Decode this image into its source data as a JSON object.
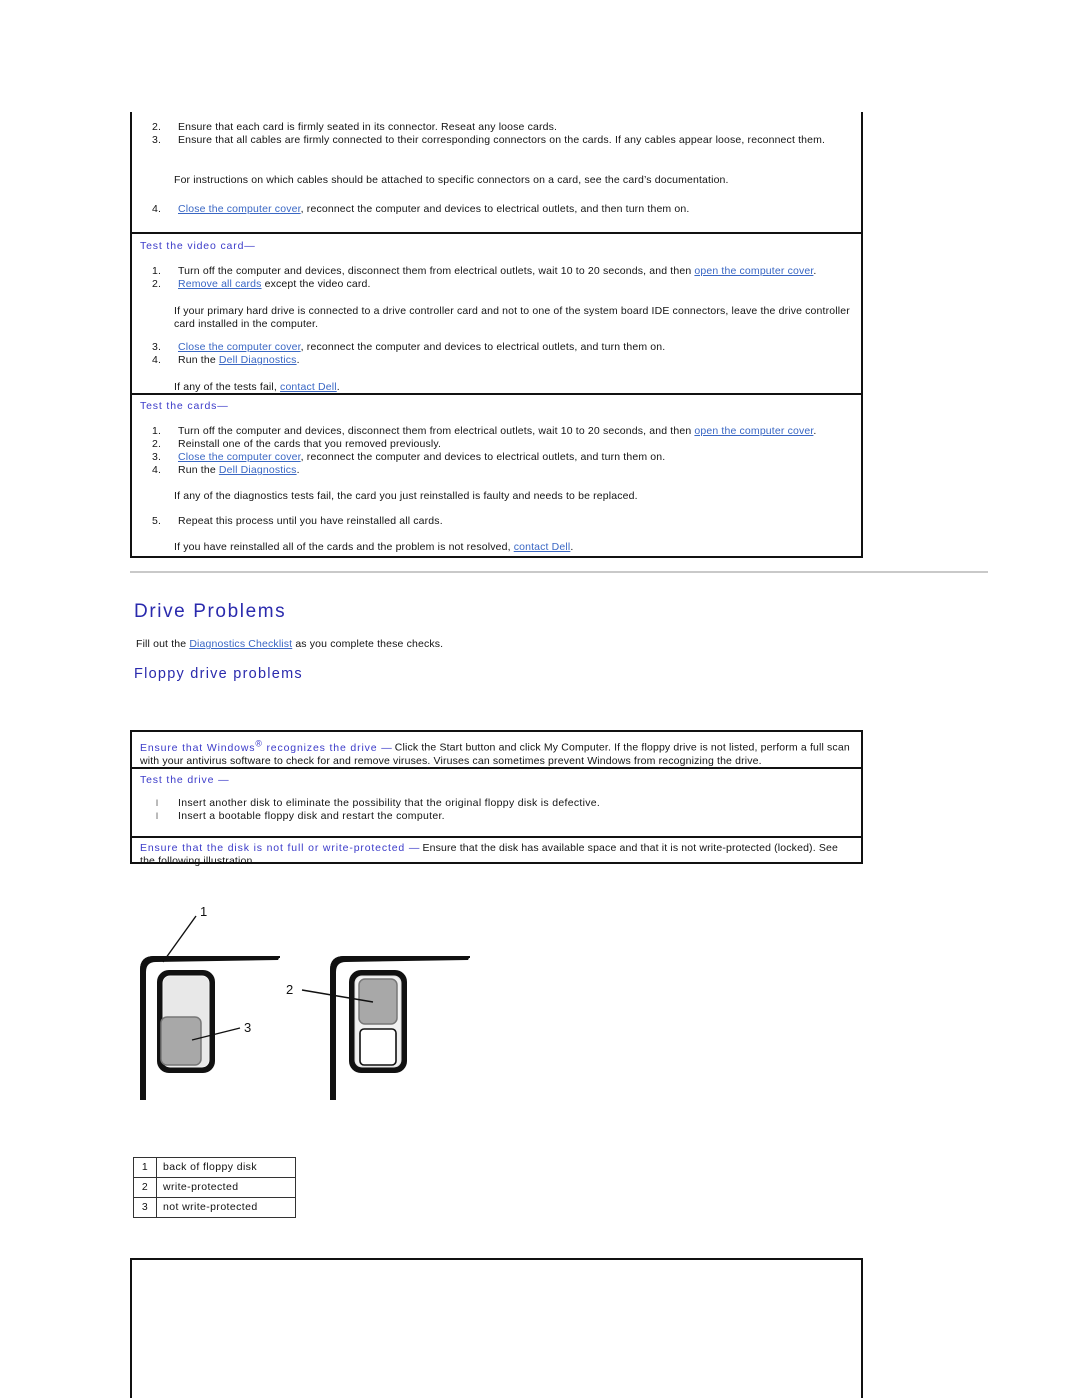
{
  "document": {
    "title": "Drive Problems"
  },
  "top_box": {
    "steps": [
      {
        "num": "2.",
        "text": "Ensure that each card is firmly seated in its connector. Reseat any loose cards."
      },
      {
        "num": "3.",
        "text": "Ensure that all cables are firmly connected to their corresponding connectors on the cards. If any cables appear loose, reconnect them."
      }
    ],
    "note": "For instructions on which cables should be attached to specific connectors on a card, see the card’s documentation.",
    "step4": {
      "num": "4.",
      "link": "Close the computer cover",
      "rest": ", reconnect the computer and devices to electrical outlets, and then turn them on."
    }
  },
  "video_card_section": {
    "heading": "Test the video card",
    "dash": "—",
    "step1": {
      "num": "1.",
      "pre": "Turn off the computer and devices, disconnect them from electrical outlets, wait 10 to 20 seconds, and then ",
      "link": "open the computer cover",
      "post": "."
    },
    "step2": {
      "num": "2.",
      "link": "Remove all cards",
      "post": " except the video card."
    },
    "note": "If your primary hard drive is connected to a drive controller card and not to one of the system board IDE connectors, leave the drive controller card installed in the computer.",
    "step3": {
      "num": "3.",
      "link": "Close the computer cover",
      "post": ", reconnect the computer and devices to electrical outlets, and turn them on."
    },
    "step4": {
      "num": "4.",
      "pre": "Run the ",
      "link": "Dell Diagnostics",
      "post": "."
    },
    "footer": {
      "pre": "If any of the tests fail, ",
      "link": "contact Dell",
      "post": "."
    }
  },
  "cards_section": {
    "heading": "Test the cards",
    "dash": "—",
    "step1": {
      "num": "1.",
      "pre": "Turn off the computer and devices, disconnect them from electrical outlets, wait 10 to 20 seconds, and then ",
      "link": "open the computer cover",
      "post": "."
    },
    "step2": {
      "num": "2.",
      "text": "Reinstall one of the cards that you removed previously."
    },
    "step3": {
      "num": "3.",
      "link": "Close the computer cover",
      "post": ", reconnect the computer and devices to electrical outlets, and turn them on."
    },
    "step4": {
      "num": "4.",
      "pre": "Run the ",
      "link": "Dell Diagnostics",
      "post": "."
    },
    "note": "If any of the diagnostics tests fail, the card you just reinstalled is faulty and needs to be replaced.",
    "step5": {
      "num": "5.",
      "text": "Repeat this process until you have reinstalled all cards."
    },
    "footer": {
      "pre": "If you have reinstalled all of the cards and the problem is not resolved, ",
      "link": "contact Dell",
      "post": "."
    }
  },
  "drive_problems": {
    "heading": "Drive Problems",
    "intro_pre": "Fill out the ",
    "intro_link": "Diagnostics Checklist",
    "intro_post": " as you complete these checks.",
    "subheading": "Floppy drive problems"
  },
  "floppy_box": {
    "windows_check": {
      "head_pre": "Ensure that Windows",
      "registered": "®",
      "head_post": " recognizes the drive",
      "dash": "—",
      "body": "Click the Start button and click My Computer. If the floppy drive is not listed, perform a full scan with your antivirus software to check for and remove viruses. Viruses can sometimes prevent Windows from recognizing the drive."
    },
    "test_drive": {
      "heading": "Test the drive",
      "dash": "—",
      "bullet_glyph": "l",
      "bullets": [
        "Insert another disk to eliminate the possibility that the original floppy disk is defective.",
        "Insert a bootable floppy disk and restart the computer."
      ]
    },
    "write_protect": {
      "heading": "Ensure that the disk is not full or write-protected",
      "dash": "—",
      "body": "Ensure that the disk has available space and that it is not write-protected (locked). See the following illustration."
    }
  },
  "illustration": {
    "callout_1": "1",
    "callout_2": "2",
    "callout_3": "3"
  },
  "legend": {
    "rows": [
      {
        "index": "1",
        "label": "back of floppy disk"
      },
      {
        "index": "2",
        "label": "write-protected"
      },
      {
        "index": "3",
        "label": "not write-protected"
      }
    ]
  },
  "colors": {
    "link": "#3a67c4",
    "heading": "#2a2aad",
    "callout_head": "#3b3bc9",
    "border": "#111111",
    "rule": "#c9c9c9"
  }
}
